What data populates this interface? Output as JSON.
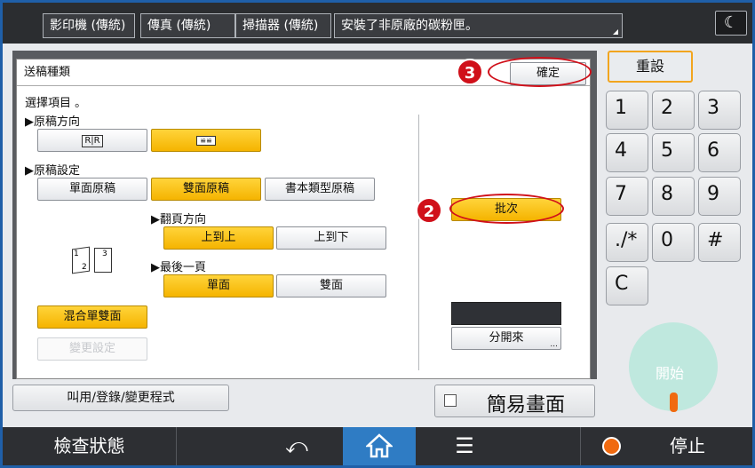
{
  "topbar": {
    "tabs": [
      "影印機 (傳統)",
      "傳真 (傳統)",
      "掃描器 (傳統)",
      "安裝了非原廠的碳粉匣。"
    ],
    "night_icon": "moon-icon"
  },
  "dialog": {
    "title": "送稿種類",
    "ok_label": "確定",
    "prompt": "選擇項目 。",
    "orientation": {
      "heading": "▶原稿方向",
      "option1_label": "R̲R",
      "option2_label": "≌"
    },
    "original_setting": {
      "heading": "▶原稿設定",
      "options": [
        "單面原稿",
        "雙面原稿",
        "書本類型原稿"
      ],
      "selected": "雙面原稿"
    },
    "page_direction": {
      "heading": "▶翻頁方向",
      "options": [
        "上到上",
        "上到下"
      ],
      "selected": "上到上"
    },
    "last_page": {
      "heading": "▶最後一頁",
      "options": [
        "單面",
        "雙面"
      ],
      "selected": "單面"
    },
    "mixed_label": "混合單雙面",
    "change_setting_label": "變更設定",
    "batch_label": "批次",
    "separate_label": "分開來",
    "separate_more": "...",
    "page_icon": "duplex-pages-icon",
    "page_numbers": [
      "1",
      "2",
      "3"
    ]
  },
  "annotations": {
    "badge2": "2",
    "badge3": "3"
  },
  "keypad": {
    "reset_label": "重設",
    "keys": [
      "1",
      "2",
      "3",
      "4",
      "5",
      "6",
      "7",
      "8",
      "9",
      "./*",
      "0",
      "#",
      "C"
    ],
    "start_label": "開始"
  },
  "bottom": {
    "program_label": "叫用/登錄/變更程式",
    "simple_screen_label": "簡易畫面",
    "check_status_label": "檢查狀態",
    "back_icon": "back-arrow-icon",
    "home_icon": "home-icon",
    "menu_icon": "menu-icon",
    "stop_icon": "stop-icon",
    "stop_label": "停止"
  },
  "colors": {
    "accent_yellow": "#f5b400",
    "annotation_red": "#d0101a",
    "frame_blue": "#1f5fa8",
    "start_teal": "#bfe8de"
  }
}
